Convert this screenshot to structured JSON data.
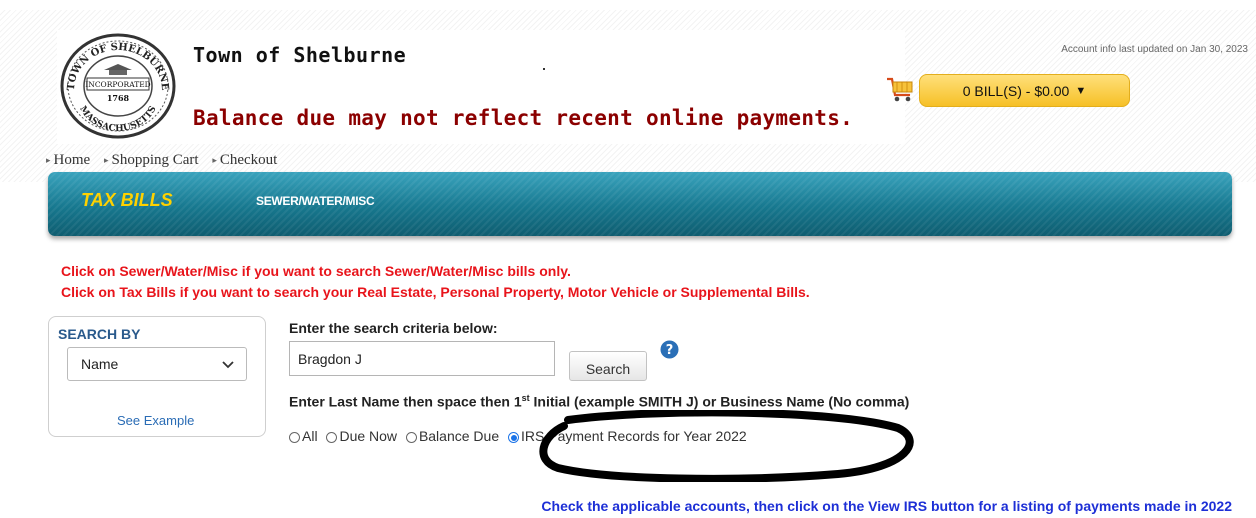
{
  "header": {
    "town_title": "Town of Shelburne",
    "balance_warning": "Balance due may not reflect recent online payments.",
    "account_updated": "Account info last updated on Jan 30, 2023",
    "seal_text": [
      "TOWN OF SHELBURNE",
      "INCORPORATED",
      "1768",
      "MASSACHUSETTS"
    ]
  },
  "cart": {
    "icon": "shopping-cart-icon",
    "bill_summary": "0 BILL(S) - $0.00",
    "caret": "▼"
  },
  "breadcrumb": {
    "items": [
      {
        "label": "Home"
      },
      {
        "label": "Shopping Cart"
      },
      {
        "label": "Checkout"
      }
    ]
  },
  "nav": {
    "tabs": [
      {
        "label": "TAX BILLS",
        "active": true
      },
      {
        "label": "SEWER/WATER/MISC",
        "active": false
      }
    ]
  },
  "instructions": {
    "line1": "Click on Sewer/Water/Misc if you want to search Sewer/Water/Misc bills only.",
    "line2": "Click on Tax Bills if you want to search your Real Estate, Personal Property, Motor Vehicle or Supplemental Bills."
  },
  "search_by": {
    "label": "SEARCH BY",
    "selected": "Name",
    "see_example": "See Example"
  },
  "search": {
    "criteria_label": "Enter the search criteria below:",
    "input_value": "Bragdon J",
    "button_label": "Search",
    "hint_before": "Enter Last Name then space then 1",
    "hint_sup": "st",
    "hint_after": " Initial (example SMITH J) or Business Name (No comma)"
  },
  "filters": {
    "options": [
      {
        "label": "All",
        "checked": false
      },
      {
        "label": "Due Now",
        "checked": false
      },
      {
        "label": "Balance Due",
        "checked": false
      },
      {
        "label": "IRS Payment Records for Year 2022",
        "checked": true
      }
    ]
  },
  "footer_note": "Check the applicable accounts, then click on the View IRS button for a listing of payments made in 2022",
  "colors": {
    "nav_teal": "#17788f",
    "tab_active": "#ffd200",
    "instruction_red": "#e8141b",
    "warning_darkred": "#8b0000",
    "note_blue": "#1d2fd6",
    "bill_button": "#f6c027"
  }
}
